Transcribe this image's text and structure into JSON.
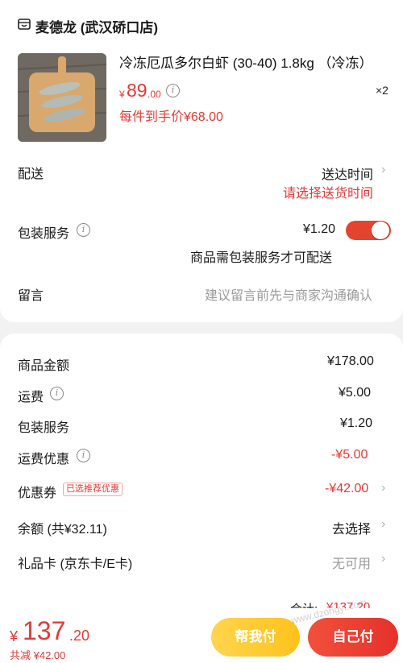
{
  "store": {
    "name": "麦德龙 (武汉硚口店)",
    "icon": "store-icon"
  },
  "product": {
    "title": "冷冻厄瓜多尔白虾 (30-40) 1.8kg （冷冻）",
    "currency": "¥",
    "price_int": "89",
    "price_dec": ".00",
    "qty": "×2",
    "promo_price": "每件到手价¥68.00"
  },
  "delivery": {
    "label": "配送",
    "time_label": "送达时间",
    "prompt": "请选择送货时间"
  },
  "packaging": {
    "label": "包装服务",
    "price": "¥1.20",
    "enabled": true,
    "note": "商品需包装服务才可配送"
  },
  "message": {
    "label": "留言",
    "placeholder": "建议留言前先与商家沟通确认"
  },
  "summary": {
    "goods_label": "商品金额",
    "goods_value": "¥178.00",
    "shipping_label": "运费",
    "shipping_value": "¥5.00",
    "packaging_label": "包装服务",
    "packaging_value": "¥1.20",
    "shipping_discount_label": "运费优惠",
    "shipping_discount_value": "-¥5.00",
    "coupon_label": "优惠券",
    "coupon_tag": "已选推荐优惠",
    "coupon_value": "-¥42.00",
    "balance_label": "余额 (共¥32.11)",
    "balance_action": "去选择",
    "giftcard_label": "礼品卡 (京东卡/E卡)",
    "giftcard_value": "无可用",
    "total_label": "合计:",
    "total_value": "¥137.20"
  },
  "footer": {
    "currency": "¥",
    "total_int": "137",
    "total_dec": ".20",
    "saved": "共减 ¥42.00",
    "help_pay_label": "帮我付",
    "self_pay_label": "自己付",
    "watermark": "www.dzorigyi.com"
  },
  "colors": {
    "accent": "#e53935",
    "help_button": "#ffc21a",
    "toggle_on": "#e4442f"
  }
}
